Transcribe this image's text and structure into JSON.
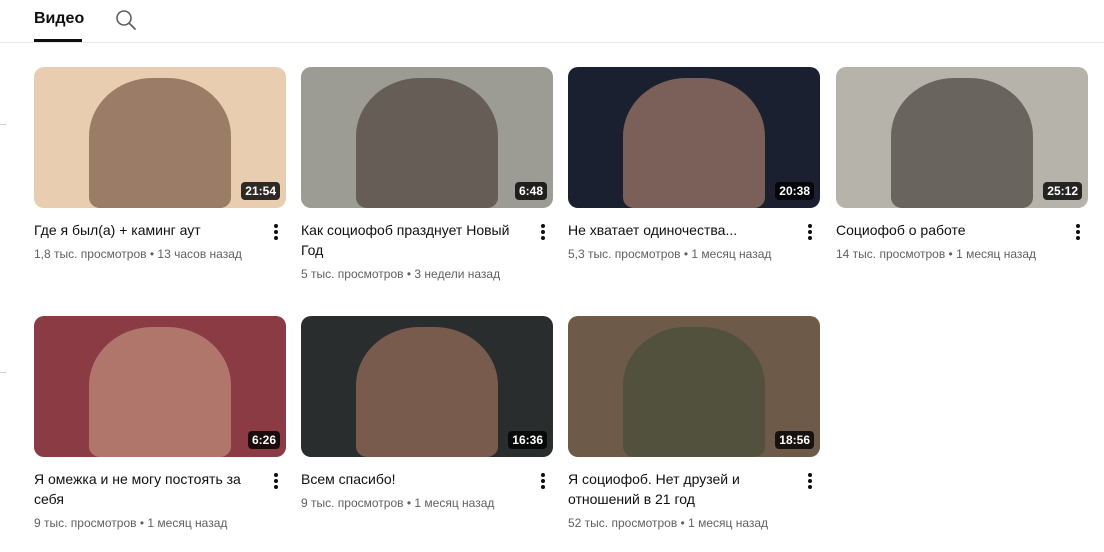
{
  "tabs": {
    "videos_label": "Видео",
    "search_icon": "search-icon"
  },
  "videos": [
    {
      "title": "Где я был(а) + каминг аут",
      "views": "1,8 тыс. просмотров",
      "age": "13 часов назад",
      "duration": "21:54",
      "thumb_bg": "#e8cdb0",
      "thumb_fg": "#5a3a2c"
    },
    {
      "title": "Как социофоб празднует Новый Год",
      "views": "5 тыс. просмотров",
      "age": "3 недели назад",
      "duration": "6:48",
      "thumb_bg": "#9c9c94",
      "thumb_fg": "#3b2a22"
    },
    {
      "title": "Не хватает одиночества...",
      "views": "5,3 тыс. просмотров",
      "age": "1 месяц назад",
      "duration": "20:38",
      "thumb_bg": "#1b2030",
      "thumb_fg": "#c9957a"
    },
    {
      "title": "Социофоб о работе",
      "views": "14 тыс. просмотров",
      "age": "1 месяц назад",
      "duration": "25:12",
      "thumb_bg": "#b5b3aa",
      "thumb_fg": "#2a221e"
    },
    {
      "title": "Я омежка и не могу постоять за себя",
      "views": "9 тыс. просмотров",
      "age": "1 месяц назад",
      "duration": "6:26",
      "thumb_bg": "#8a3b44",
      "thumb_fg": "#d0a58c"
    },
    {
      "title": "Всем спасибо!",
      "views": "9 тыс. просмотров",
      "age": "1 месяц назад",
      "duration": "16:36",
      "thumb_bg": "#2a2d2e",
      "thumb_fg": "#b98269"
    },
    {
      "title": "Я социофоб. Нет друзей и отношений в 21 год",
      "views": "52 тыс. просмотров",
      "age": "1 месяц назад",
      "duration": "18:56",
      "thumb_bg": "#6d5a48",
      "thumb_fg": "#3d4a36"
    }
  ],
  "meta_separator": " • "
}
